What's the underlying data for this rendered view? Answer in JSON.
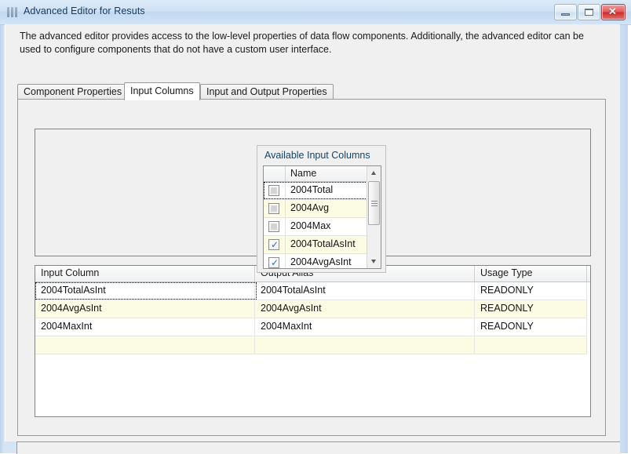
{
  "window": {
    "title": "Advanced Editor for Resuts",
    "icon": "columns-icon",
    "controls": {
      "minimize": "minimize-icon",
      "maximize": "maximize-icon",
      "close": "✕"
    }
  },
  "description": "The advanced editor provides access to the low-level properties of data flow components. Additionally, the advanced editor can be used to configure components that do not have a custom user interface.",
  "tabs": [
    {
      "label": "Component Properties",
      "active": false
    },
    {
      "label": "Input Columns",
      "active": true
    },
    {
      "label": "Input and Output Properties",
      "active": false
    }
  ],
  "available_input_columns": {
    "title": "Available Input Columns",
    "header": {
      "checkbox_col": "",
      "name": "Name"
    },
    "rows": [
      {
        "name": "2004Total",
        "checked": false,
        "focused": true
      },
      {
        "name": "2004Avg",
        "checked": false,
        "focused": false
      },
      {
        "name": "2004Max",
        "checked": false,
        "focused": false
      },
      {
        "name": "2004TotalAsInt",
        "checked": true,
        "focused": false
      },
      {
        "name": "2004AvgAsInt",
        "checked": true,
        "focused": false
      }
    ],
    "scrollbar": {
      "up_arrow": "scroll-up-icon",
      "down_arrow": "scroll-down-icon"
    }
  },
  "input_columns_grid": {
    "columns": [
      "Input Column",
      "Output Alias",
      "Usage Type"
    ],
    "rows": [
      {
        "input_column": "2004TotalAsInt",
        "output_alias": "2004TotalAsInt",
        "usage_type": "READONLY",
        "focused": true
      },
      {
        "input_column": "2004AvgAsInt",
        "output_alias": "2004AvgAsInt",
        "usage_type": "READONLY",
        "focused": false
      },
      {
        "input_column": "2004MaxInt",
        "output_alias": "2004MaxInt",
        "usage_type": "READONLY",
        "focused": false
      },
      {
        "input_column": "",
        "output_alias": "",
        "usage_type": "",
        "focused": false
      }
    ]
  },
  "colors": {
    "accent": "#11446b",
    "alt_row": "#fcfbe3",
    "title_text": "#14395e",
    "close_button": "#cc2b2b"
  }
}
